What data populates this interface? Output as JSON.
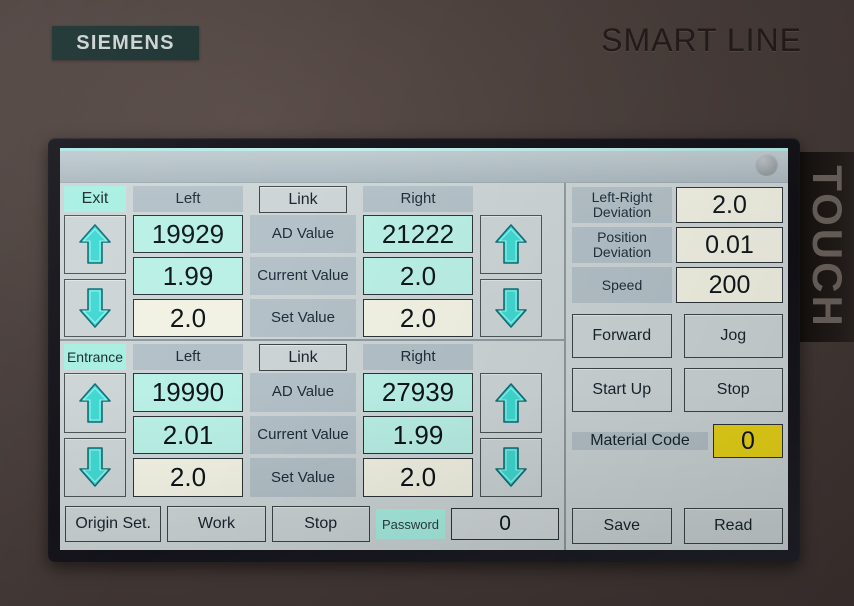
{
  "branding": {
    "logo": "SIEMENS",
    "model": "SMART LINE",
    "side_tab": "TOUCH"
  },
  "screen": {
    "titlebar": {
      "indicator": "status-dot"
    },
    "sections": [
      {
        "tag": "Exit",
        "header": {
          "left": "Left",
          "link": "Link",
          "right": "Right"
        },
        "rows": [
          {
            "label": "AD Value",
            "left": "19929",
            "right": "21222"
          },
          {
            "label": "Current Value",
            "left": "1.99",
            "right": "2.0"
          },
          {
            "label": "Set Value",
            "left": "2.0",
            "right": "2.0"
          }
        ]
      },
      {
        "tag": "Entrance",
        "header": {
          "left": "Left",
          "link": "Link",
          "right": "Right"
        },
        "rows": [
          {
            "label": "AD Value",
            "left": "19990",
            "right": "27939"
          },
          {
            "label": "Current Value",
            "left": "2.01",
            "right": "1.99"
          },
          {
            "label": "Set Value",
            "left": "2.0",
            "right": "2.0"
          }
        ]
      }
    ],
    "bottom_bar": {
      "origin_set": "Origin Set.",
      "work": "Work",
      "stop": "Stop",
      "password_label": "Password",
      "password_value": "0"
    },
    "right_panel": {
      "readouts": [
        {
          "label": "Left-Right Deviation",
          "value": "2.0"
        },
        {
          "label": "Position Deviation",
          "value": "0.01"
        },
        {
          "label": "Speed",
          "value": "200"
        }
      ],
      "buttons": {
        "forward": "Forward",
        "jog": "Jog",
        "start_up": "Start Up",
        "stop": "Stop"
      },
      "material": {
        "label": "Material Code",
        "value": "0"
      },
      "save": "Save",
      "read": "Read"
    }
  },
  "colors": {
    "accent_cyan": "#a8efe2",
    "field_cyan": "#b9f0e6",
    "field_ivory": "#f2f2e4",
    "label_blue": "#b3c0c7",
    "alarm_yellow": "#e8d318",
    "screen_bg": "#ccd4d6",
    "arrow_fill": "#3ed6cf"
  }
}
